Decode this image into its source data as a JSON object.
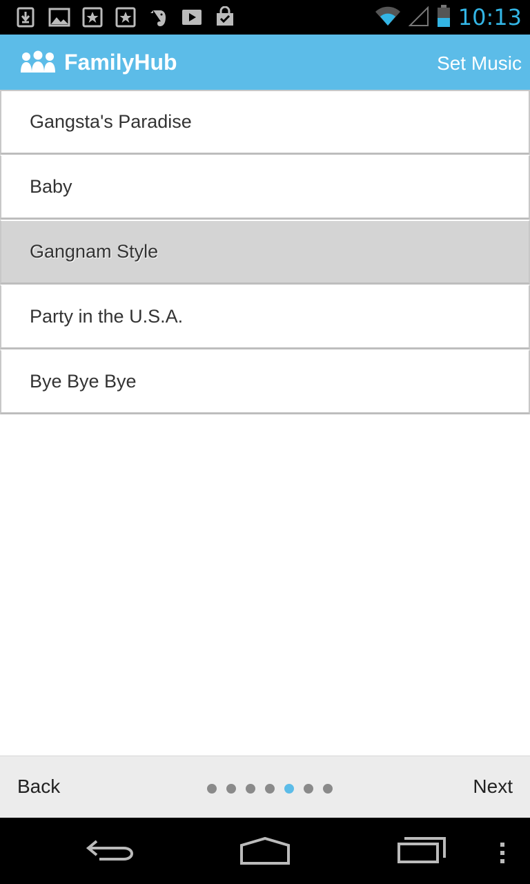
{
  "status_bar": {
    "time": "10:13",
    "notification_icons": [
      "download-icon",
      "image-icon",
      "starred-doc-icon",
      "starred-doc-icon",
      "evernote-icon",
      "play-store-icon",
      "shopping-bag-icon"
    ],
    "accent": "#33b5e5"
  },
  "action_bar": {
    "title": "FamilyHub",
    "action_label": "Set Music",
    "color": "#5cbce8"
  },
  "songs": [
    {
      "label": "Gangsta's Paradise",
      "selected": false
    },
    {
      "label": "Baby",
      "selected": false
    },
    {
      "label": "Gangnam Style",
      "selected": true
    },
    {
      "label": "Party in the U.S.A.",
      "selected": false
    },
    {
      "label": "Bye Bye Bye",
      "selected": false
    }
  ],
  "pager": {
    "back_label": "Back",
    "next_label": "Next",
    "total_pages": 7,
    "current_page": 5
  }
}
